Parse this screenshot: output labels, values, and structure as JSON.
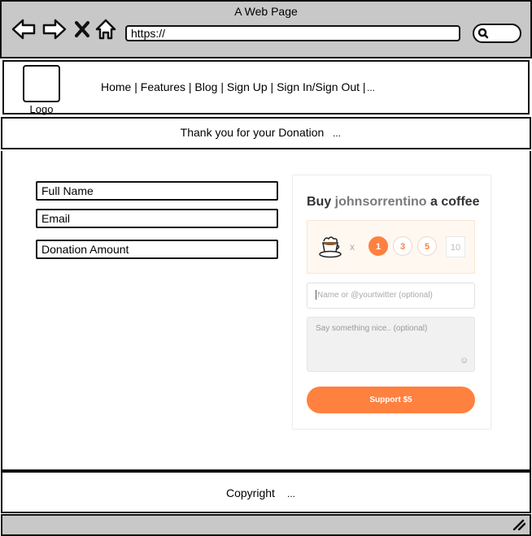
{
  "browser": {
    "title": "A Web Page",
    "url": "https://",
    "icons": [
      "back-arrow-icon",
      "forward-arrow-icon",
      "close-x-icon",
      "home-icon",
      "search-icon"
    ]
  },
  "header": {
    "logo_label": "Logo",
    "nav_text": "Home | Features | Blog | Sign Up | Sign In/Sign Out |",
    "nav_more": "..."
  },
  "banner": {
    "text": "Thank you for your Donation",
    "more": "..."
  },
  "form": {
    "full_name": "Full Name",
    "email": "Email",
    "donation_amount": "Donation Amount"
  },
  "widget": {
    "title_prefix": "Buy ",
    "username": "johnsorrentino",
    "title_suffix": " a coffee",
    "times": "x",
    "quantities": [
      "1",
      "3",
      "5"
    ],
    "custom_quantity": "10",
    "selected_quantity": "1",
    "name_placeholder": "Name or @yourtwitter (optional)",
    "message_placeholder": "Say something nice.. (optional)",
    "support_label": "Support $5",
    "accent_color": "#ff813f"
  },
  "footer": {
    "text": "Copyright",
    "more": "..."
  }
}
